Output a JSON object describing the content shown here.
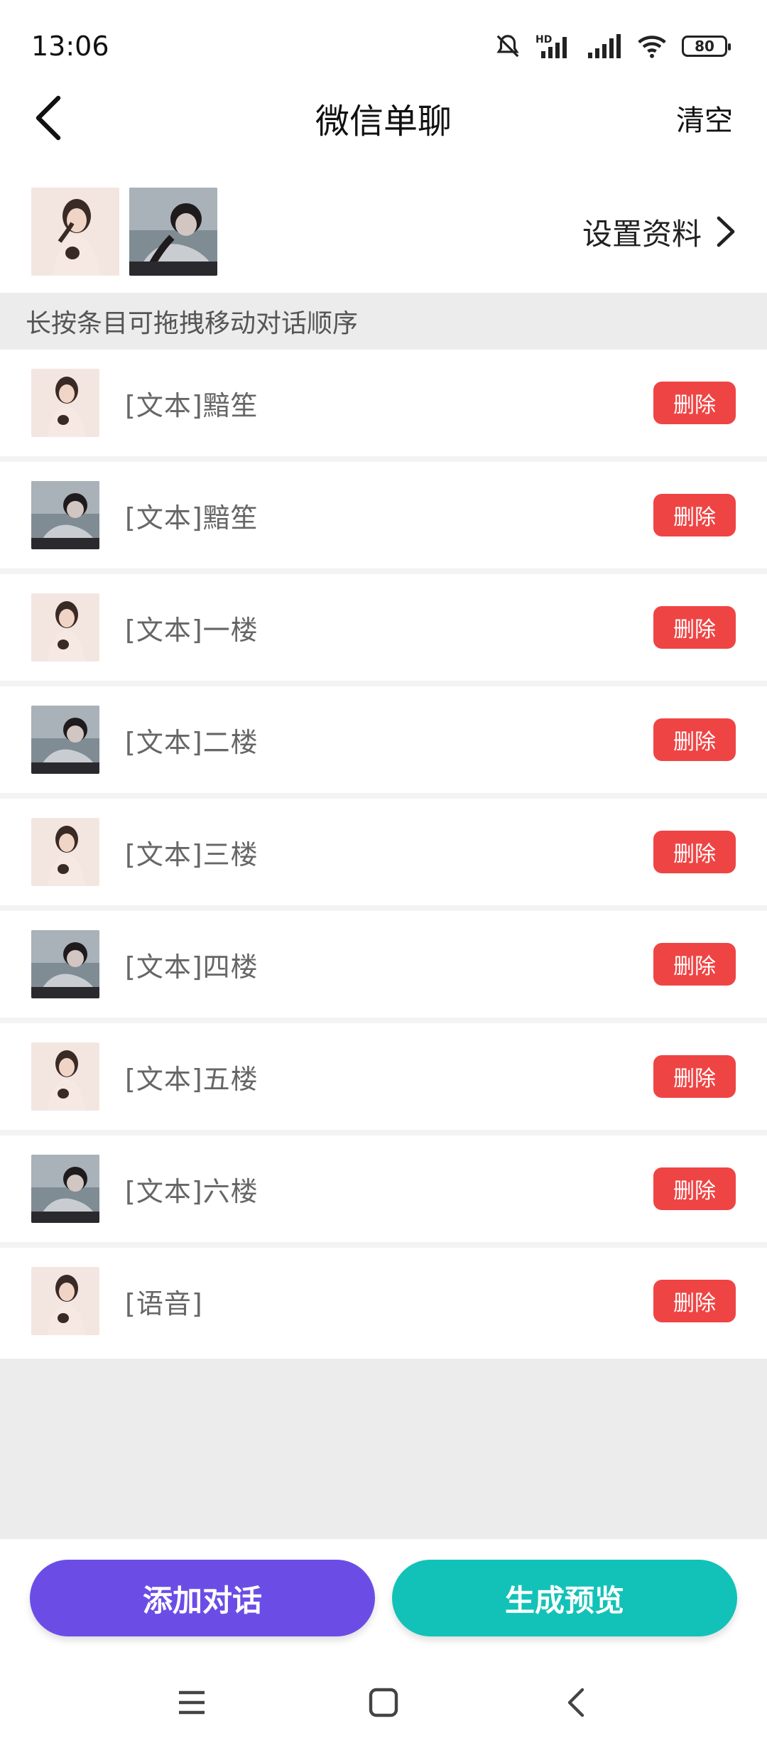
{
  "status_bar": {
    "time": "13:06",
    "battery": "80"
  },
  "header": {
    "title": "微信单聊",
    "clear_label": "清空"
  },
  "profile": {
    "setting_label": "设置资料"
  },
  "hint": "长按条目可拖拽移动对话顺序",
  "messages": [
    {
      "text": "[文本]黯笙",
      "avatar": "female-avatar",
      "delete_label": "删除"
    },
    {
      "text": "[文本]黯笙",
      "avatar": "male-avatar",
      "delete_label": "删除"
    },
    {
      "text": "[文本]一楼",
      "avatar": "female-avatar",
      "delete_label": "删除"
    },
    {
      "text": "[文本]二楼",
      "avatar": "male-avatar",
      "delete_label": "删除"
    },
    {
      "text": "[文本]三楼",
      "avatar": "female-avatar",
      "delete_label": "删除"
    },
    {
      "text": "[文本]四楼",
      "avatar": "male-avatar",
      "delete_label": "删除"
    },
    {
      "text": "[文本]五楼",
      "avatar": "female-avatar",
      "delete_label": "删除"
    },
    {
      "text": "[文本]六楼",
      "avatar": "male-avatar",
      "delete_label": "删除"
    },
    {
      "text": "[语音]",
      "avatar": "female-avatar",
      "delete_label": "删除"
    }
  ],
  "actions": {
    "add_label": "添加对话",
    "preview_label": "生成预览"
  },
  "colors": {
    "delete": "#ef4444",
    "add": "#6b4de6",
    "preview": "#12c2b8"
  }
}
